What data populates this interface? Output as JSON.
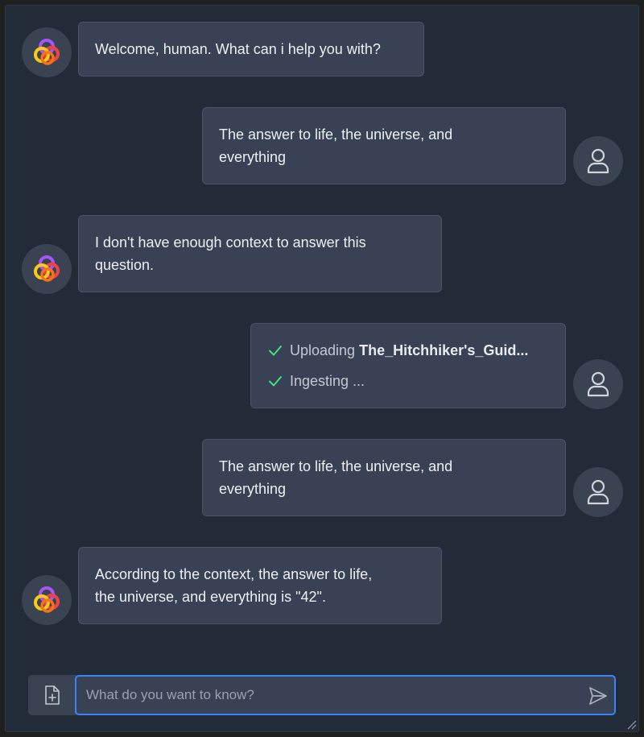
{
  "messages": [
    {
      "role": "assistant",
      "lines": [
        "Welcome, human. What can i help you with?"
      ]
    },
    {
      "role": "user",
      "lines": [
        "The answer to life, the universe, and",
        "everything"
      ]
    },
    {
      "role": "assistant",
      "lines": [
        "I don't have enough context to answer this",
        "question."
      ]
    },
    {
      "role": "user",
      "status": [
        {
          "label": "Uploading",
          "detail": "The_Hitchhiker's_Guid..."
        },
        {
          "label": "Ingesting ...",
          "detail": ""
        }
      ]
    },
    {
      "role": "user",
      "lines": [
        "The answer to life, the universe, and",
        "everything"
      ]
    },
    {
      "role": "assistant",
      "lines": [
        "According to the context, the answer to life,",
        "the universe, and everything is \"42\"."
      ]
    }
  ],
  "input": {
    "placeholder": "What do you want to know?",
    "value": ""
  },
  "icons": {
    "assistant_avatar": "colorful-swirl-logo-icon",
    "user_avatar": "user-silhouette-icon",
    "attach": "file-plus-icon",
    "send": "paper-plane-icon",
    "check": "check-icon"
  },
  "colors": {
    "accent": "#3b82f6",
    "check": "#4ade80"
  }
}
